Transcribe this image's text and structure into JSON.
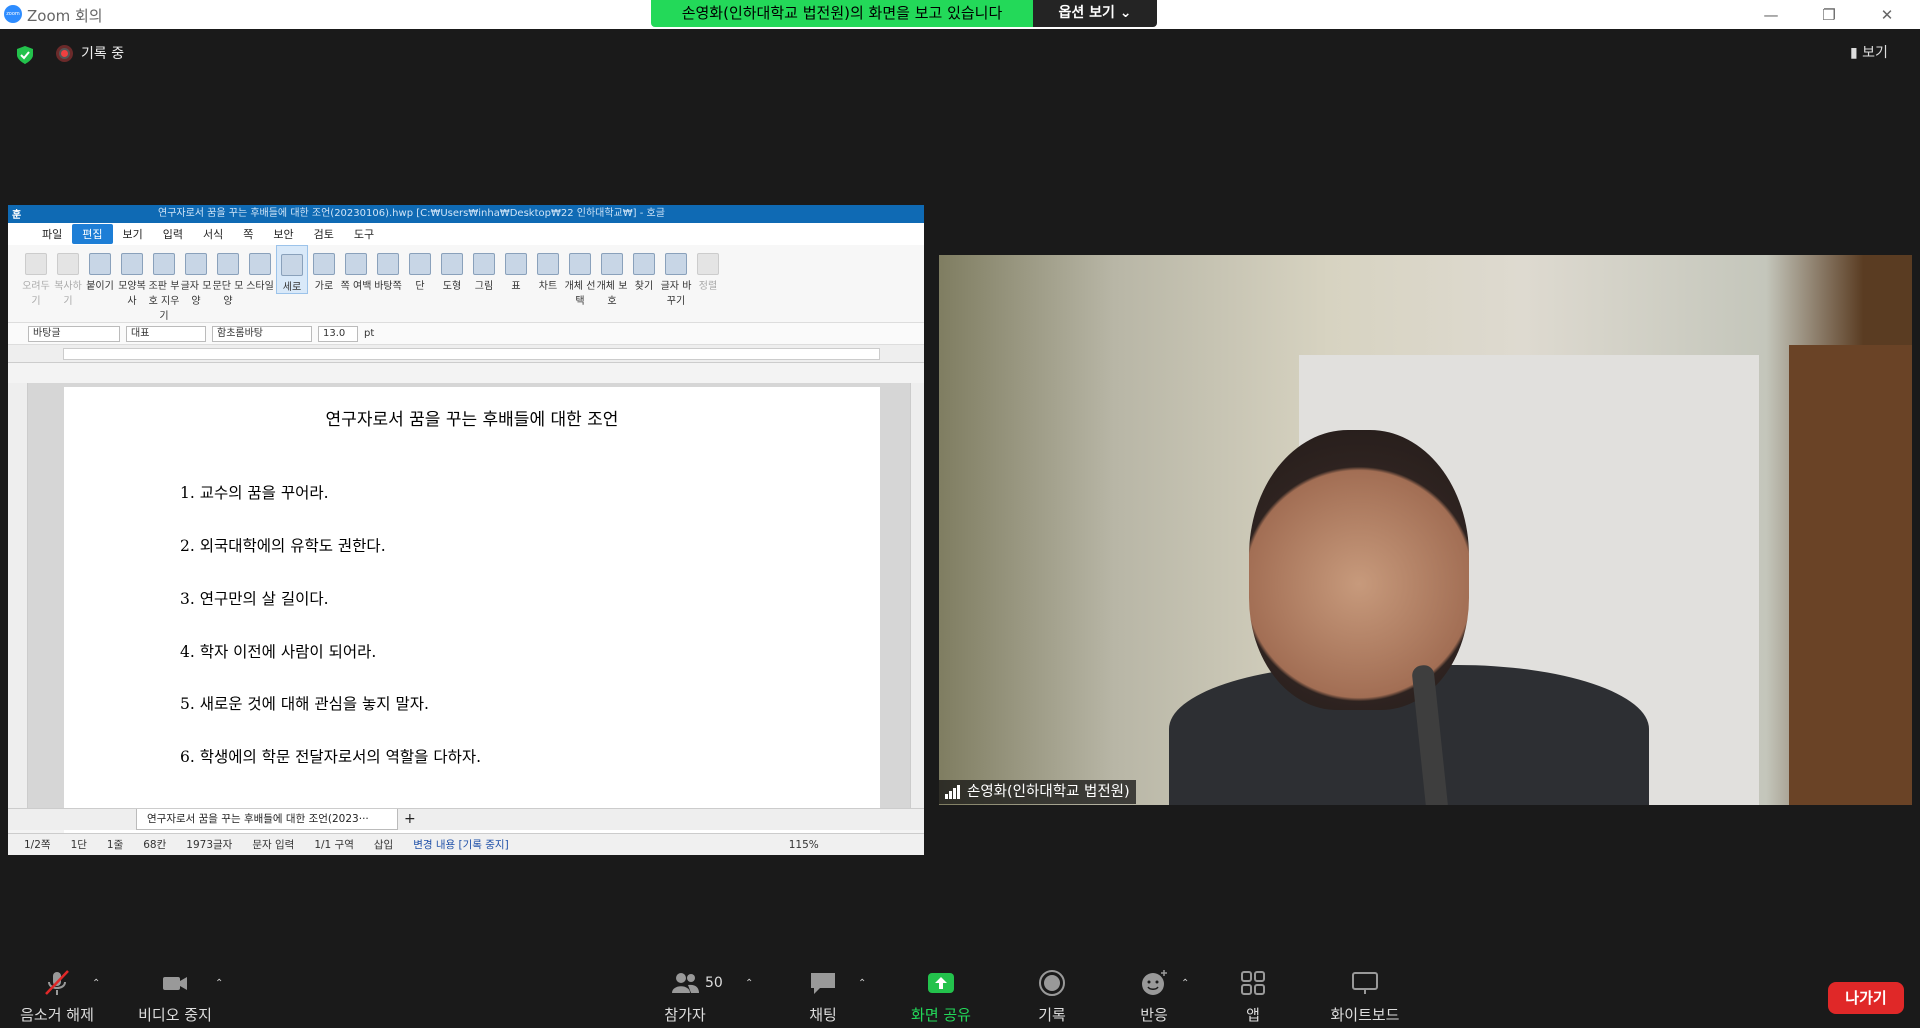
{
  "window": {
    "title": "Zoom 회의",
    "logo": "zoom"
  },
  "banner": {
    "message": "손영화(인하대학교 법전원)의 화면을 보고 있습니다",
    "options": "옵션 보기"
  },
  "status": {
    "recording": "기록 중",
    "view": "보기"
  },
  "hwp": {
    "title": "연구자로서 꿈을 꾸는 후배들에 대한 조언(20230106).hwp [C:₩Users₩inha₩Desktop₩22 인하대학교₩] - 호글",
    "menu": [
      "파일",
      "편집",
      "보기",
      "입력",
      "서식",
      "쪽",
      "보안",
      "검토",
      "도구"
    ],
    "ribbon": [
      "오려두기",
      "복사하기",
      "붙이기",
      "모양복사",
      "조판 부호 지우기",
      "글자 모양",
      "문단 모양",
      "스타일",
      "세로",
      "가로",
      "쪽 여백",
      "바탕쪽",
      "단",
      "도형",
      "그림",
      "표",
      "차트",
      "개체 선택",
      "개체 보호",
      "찾기",
      "글자 바꾸기",
      "정렬"
    ],
    "format": {
      "style": "바탕글",
      "lang": "대표",
      "font": "함초롬바탕",
      "size": "13.0",
      "unit": "pt"
    },
    "doc_title": "연구자로서 꿈을 꾸는 후배들에 대한 조언",
    "items": [
      "1. 교수의 꿈을 꾸어라.",
      "2. 외국대학에의 유학도 권한다.",
      "3. 연구만의 살 길이다.",
      "4. 학자 이전에 사람이 되어라.",
      "5. 새로운 것에 대해 관심을 놓지 말자.",
      "6. 학생에의 학문 전달자로서의 역할을 다하자."
    ],
    "tab": "연구자로서 꿈을 꾸는 후배들에 대한 조언(2023···",
    "statusbar": [
      "1/2쪽",
      "1단",
      "1줄",
      "68칸",
      "1973글자",
      "문자 입력",
      "1/1 구역",
      "삽입",
      "변경 내용 [기록 중지]"
    ],
    "zoom": "115%"
  },
  "video": {
    "participant": "손영화(인하대학교 법전원)"
  },
  "toolbar": {
    "mute": "음소거 해제",
    "video": "비디오 중지",
    "participants": "참가자",
    "participant_count": "50",
    "chat": "채팅",
    "share": "화면 공유",
    "record": "기록",
    "reactions": "반응",
    "apps": "앱",
    "whiteboard": "화이트보드",
    "leave": "나가기"
  },
  "colors": {
    "share_green": "#23d959",
    "leave_red": "#e02828",
    "zoom_blue": "#2d8cff"
  }
}
